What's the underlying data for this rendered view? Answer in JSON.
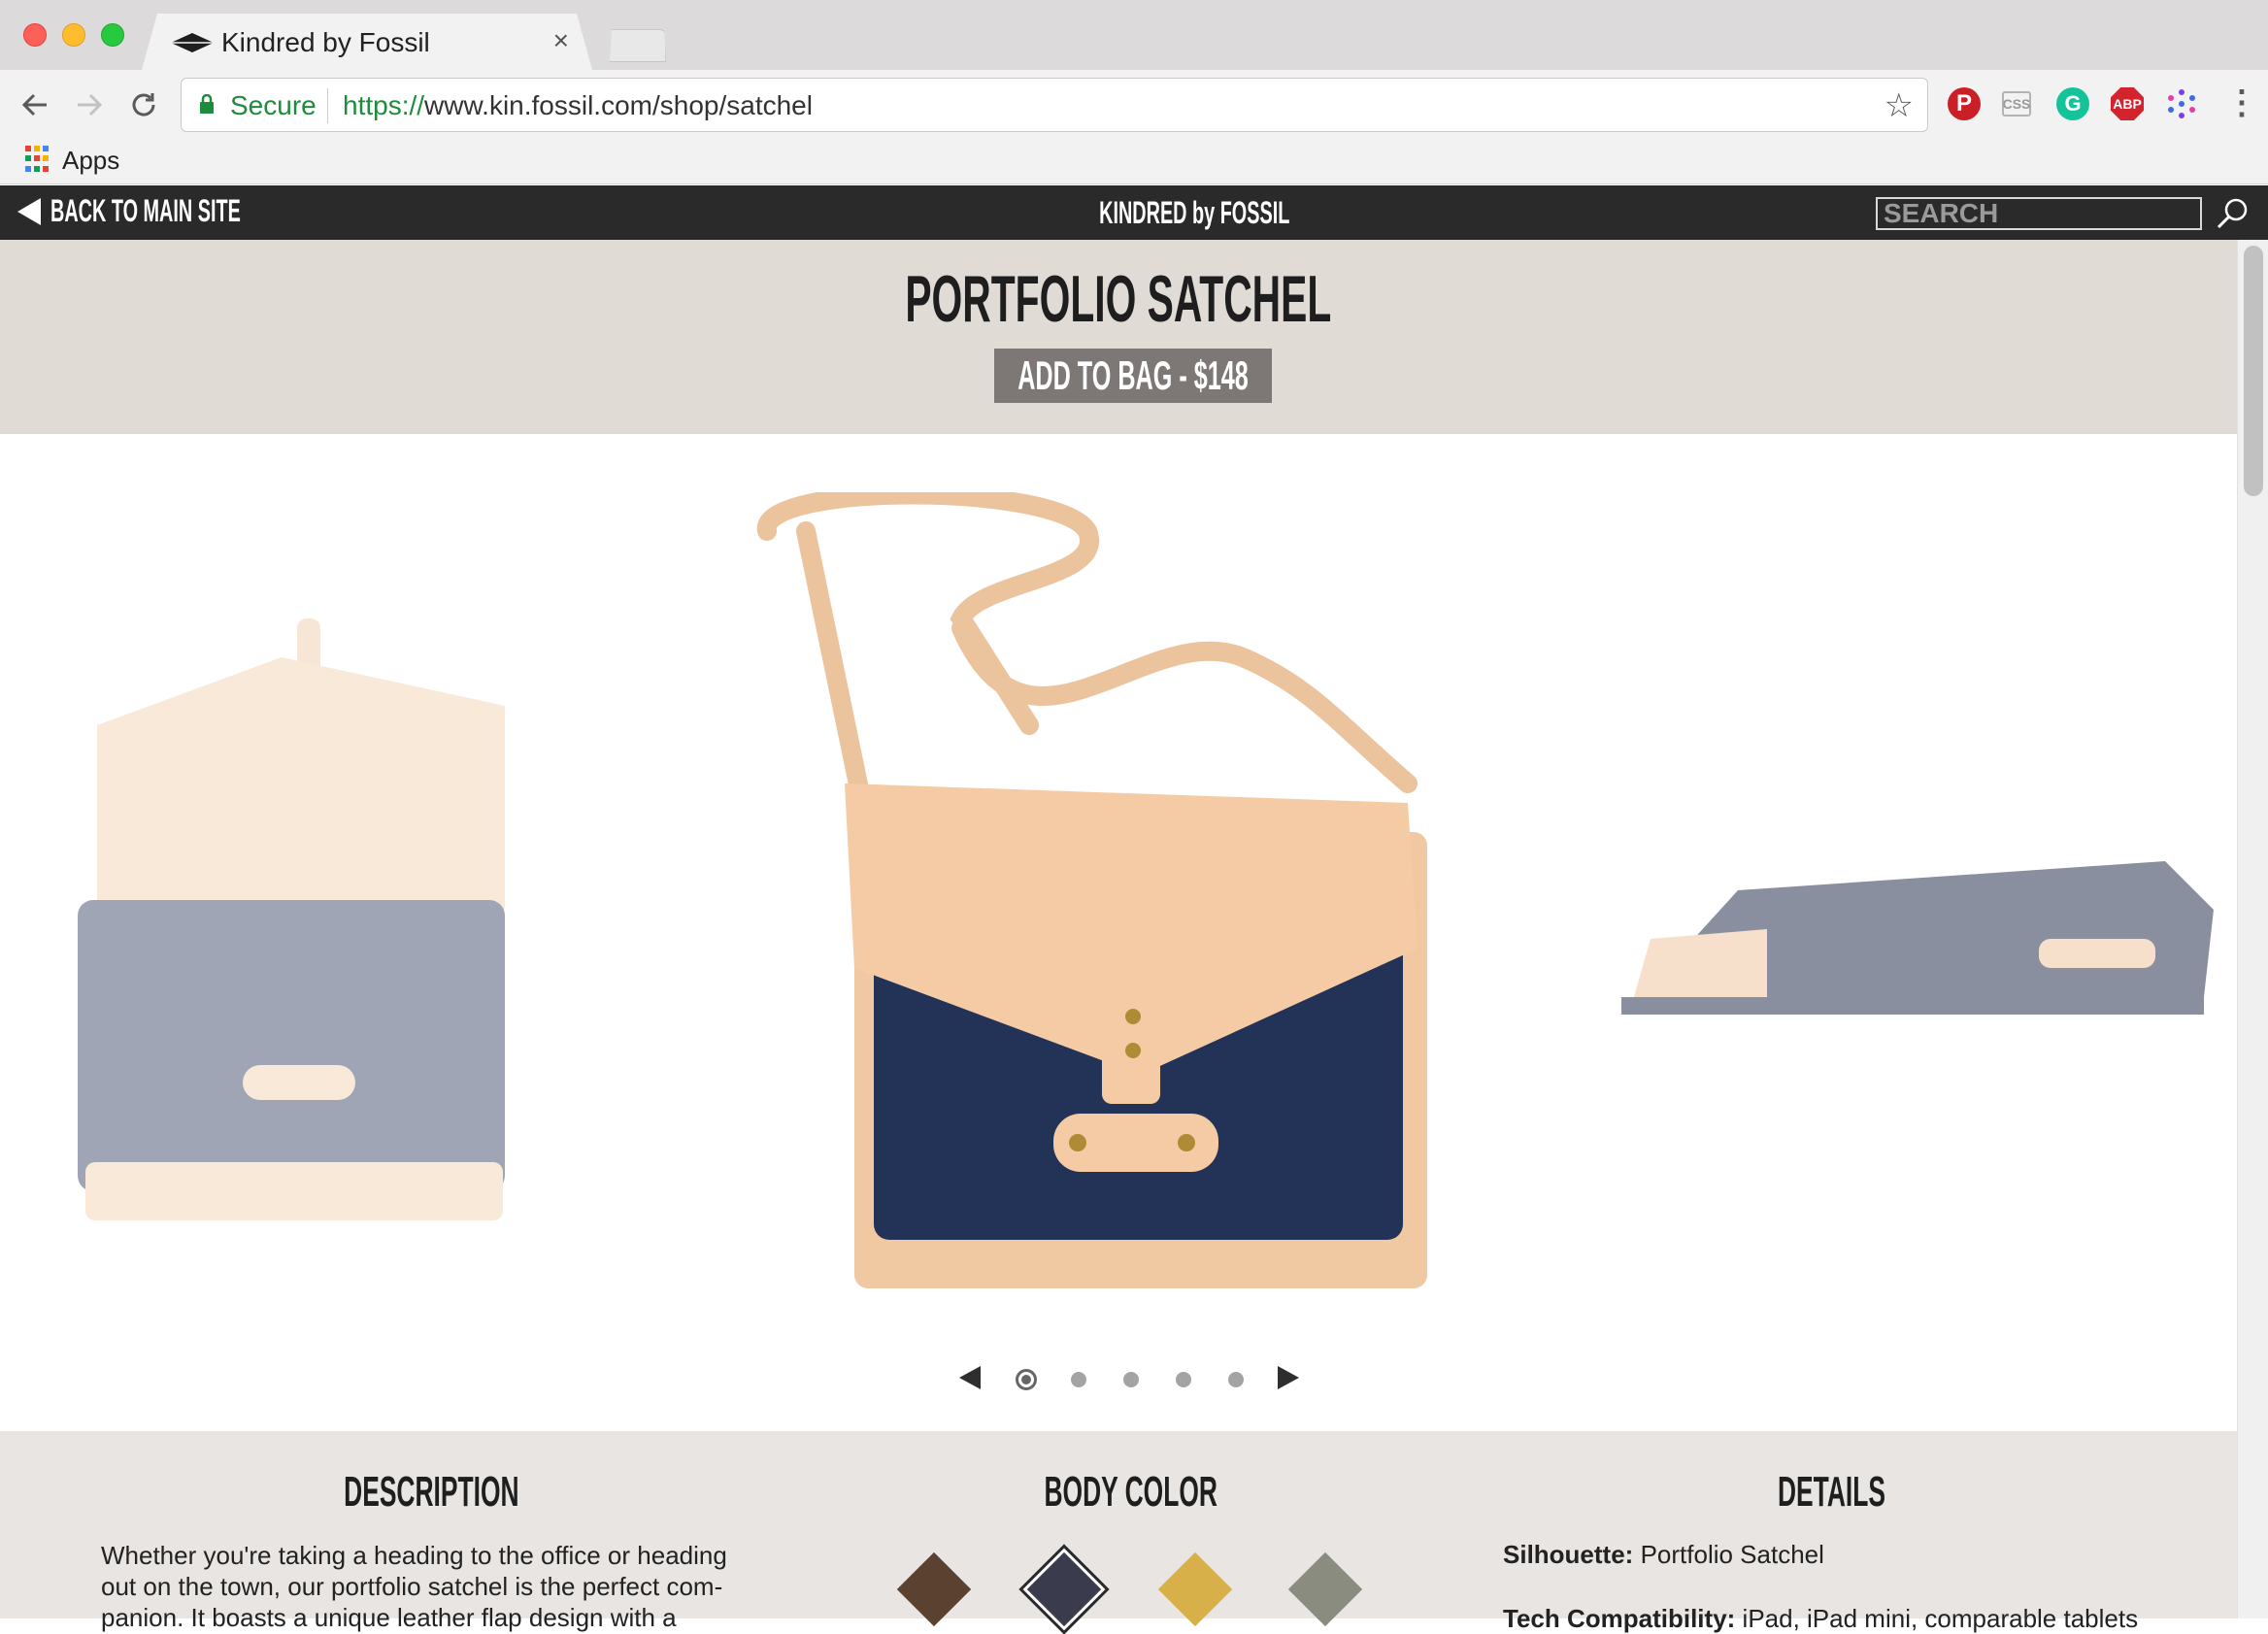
{
  "browser": {
    "tab_title": "Kindred by Fossil",
    "tab_close": "×",
    "secure_label": "Secure",
    "url_scheme": "https://",
    "url_rest": "www.kin.fossil.com/shop/satchel",
    "bookmarks_apps": "Apps",
    "extensions": [
      "pinterest-icon",
      "css-viewer-icon",
      "grammarly-icon",
      "adblock-plus-icon",
      "extension-dots-icon"
    ]
  },
  "site_nav": {
    "back_label": "BACK TO MAIN SITE",
    "brand": "KINDRED by FOSSIL",
    "search_placeholder": "SEARCH"
  },
  "product": {
    "title": "PORTFOLIO SATCHEL",
    "add_button": "ADD TO BAG - $148"
  },
  "carousel": {
    "slides_total": 5,
    "active_slide": 1,
    "images": [
      "satchel-open-faded",
      "satchel-front-main",
      "satchel-side-faded"
    ]
  },
  "info": {
    "description": {
      "heading": "DESCRIPTION",
      "text": "Whether you're taking a heading to the office or heading out on the town, our portfolio satchel is the perfect com-panion. It boasts a unique leather flap design with a"
    },
    "body_color": {
      "heading": "BODY COLOR",
      "swatches": [
        "#5b4230",
        "#3b3b4e",
        "#d8b04a",
        "#8b8c80"
      ],
      "selected_index": 1
    },
    "details": {
      "heading": "DETAILS",
      "rows": [
        {
          "label": "Silhouette:",
          "value": "Portfolio Satchel"
        },
        {
          "label": "Tech Compatibility:",
          "value": "iPad, iPad mini, comparable tablets"
        }
      ]
    }
  }
}
